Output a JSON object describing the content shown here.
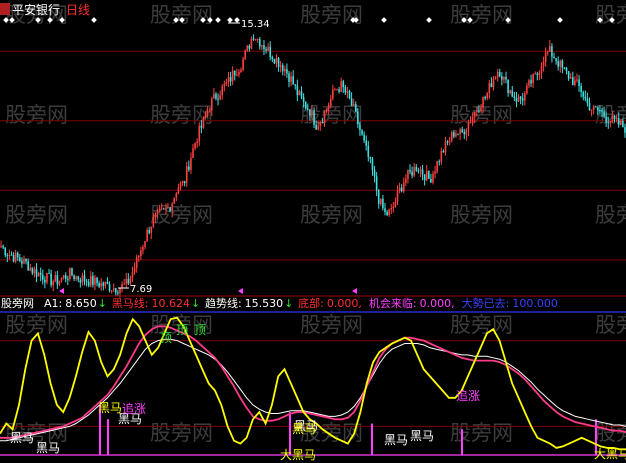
{
  "title": {
    "stock": "平安银行",
    "period": "日线"
  },
  "watermark": "股旁网",
  "price_panel": {
    "high_label": "15.34",
    "low_label": "7.69"
  },
  "indicator_header": {
    "name": "股旁网",
    "items": [
      {
        "label": "A1:",
        "value": "8.650",
        "arrow": "↓",
        "color": "#ffffff"
      },
      {
        "label": "黑马线:",
        "value": "10.624",
        "arrow": "↓",
        "color": "#ff3030"
      },
      {
        "label": "趋势线:",
        "value": "15.530",
        "arrow": "↓",
        "color": "#ffffff"
      },
      {
        "label": "底部:",
        "value": "0.000,",
        "arrow": "",
        "color": "#ff3030"
      },
      {
        "label": "机会来临:",
        "value": "0.000,",
        "arrow": "",
        "color": "#ff40ff"
      },
      {
        "label": "大勢已去:",
        "value": "100.000",
        "arrow": "",
        "color": "#4040ff"
      }
    ]
  },
  "annotations": [
    {
      "text": "黑马",
      "color": "#ffffff"
    },
    {
      "text": "黑马",
      "color": "#ffffff"
    },
    {
      "text": "黑马",
      "color": "#ffffff"
    },
    {
      "text": "黑马",
      "color": "#ffff00"
    },
    {
      "text": "追涨",
      "color": "#ff40ff"
    },
    {
      "text": "黑马",
      "color": "#ffffff"
    },
    {
      "text": "顶",
      "color": "#30e030"
    },
    {
      "text": "顶",
      "color": "#30e030"
    },
    {
      "text": "顶",
      "color": "#30e030"
    },
    {
      "text": "黑马",
      "color": "#ffff00"
    },
    {
      "text": "黑马",
      "color": "#ffffff"
    },
    {
      "text": "黑马",
      "color": "#ffffff"
    },
    {
      "text": "大黑马",
      "color": "#ffff00"
    },
    {
      "text": "追涨",
      "color": "#ff40ff"
    },
    {
      "text": "大黑马",
      "color": "#ffff00"
    }
  ],
  "chart_data": [
    {
      "type": "candlestick",
      "title": "平安银行 日线",
      "ylim": [
        7.69,
        15.34
      ],
      "y_gridlines": [
        8.5,
        10.5,
        12.5,
        14.5
      ],
      "close_profile": [
        8.9,
        8.7,
        8.6,
        8.5,
        8.4,
        8.2,
        8.1,
        8.0,
        7.9,
        7.9,
        8.0,
        8.1,
        8.0,
        7.95,
        7.9,
        7.85,
        7.8,
        7.75,
        7.7,
        7.72,
        7.8,
        8.2,
        8.7,
        9.2,
        9.6,
        9.8,
        9.9,
        10.1,
        10.6,
        10.7,
        11.4,
        12.0,
        12.4,
        12.9,
        13.2,
        13.4,
        13.6,
        13.9,
        14.1,
        14.5,
        15.0,
        14.8,
        14.6,
        14.4,
        14.2,
        14.0,
        13.7,
        13.3,
        13.0,
        12.8,
        12.4,
        12.6,
        13.0,
        13.4,
        13.5,
        13.2,
        12.8,
        12.2,
        11.6,
        11.0,
        10.2,
        9.8,
        9.9,
        10.4,
        10.8,
        11.0,
        11.2,
        11.0,
        10.8,
        11.2,
        11.6,
        11.9,
        12.2,
        12.1,
        12.4,
        12.7,
        13.0,
        13.2,
        13.7,
        14.0,
        13.6,
        13.3,
        13.1,
        13.2,
        13.6,
        13.8,
        14.3,
        14.5,
        14.3,
        14.0,
        13.8,
        13.6,
        13.4,
        13.0,
        12.8,
        12.8,
        12.6,
        12.5,
        12.4,
        12.3
      ]
    },
    {
      "type": "line",
      "title": "股旁网",
      "ylim": [
        0,
        100
      ],
      "series": [
        {
          "name": "A1",
          "color": "#ffff00",
          "values": [
            15,
            22,
            18,
            35,
            60,
            80,
            85,
            70,
            50,
            35,
            30,
            40,
            55,
            72,
            86,
            80,
            65,
            55,
            60,
            70,
            85,
            95,
            90,
            80,
            70,
            75,
            85,
            95,
            96,
            90,
            80,
            70,
            60,
            50,
            45,
            35,
            20,
            10,
            8,
            12,
            25,
            30,
            22,
            35,
            55,
            60,
            50,
            40,
            30,
            25,
            22,
            18,
            15,
            12,
            10,
            8,
            15,
            30,
            50,
            65,
            72,
            75,
            78,
            80,
            82,
            80,
            70,
            60,
            55,
            50,
            45,
            40,
            40,
            45,
            55,
            65,
            75,
            85,
            88,
            80,
            65,
            50,
            40,
            30,
            20,
            12,
            10,
            8,
            5,
            6,
            8,
            10,
            12,
            10,
            8,
            6,
            5,
            5,
            4,
            4
          ]
        },
        {
          "name": "黑马线",
          "color": "#ff3a8a",
          "values": [
            12,
            12,
            12,
            13,
            14,
            15,
            16,
            17,
            18,
            19,
            20,
            22,
            24,
            26,
            30,
            34,
            38,
            42,
            48,
            55,
            62,
            70,
            78,
            84,
            88,
            90,
            90,
            89,
            87,
            85,
            83,
            80,
            76,
            72,
            68,
            62,
            55,
            48,
            40,
            33,
            27,
            25,
            24,
            24,
            25,
            27,
            29,
            30,
            30,
            29,
            28,
            27,
            26,
            25,
            25,
            26,
            30,
            38,
            48,
            58,
            68,
            74,
            78,
            80,
            82,
            82,
            81,
            80,
            78,
            76,
            74,
            72,
            70,
            68,
            67,
            66,
            66,
            66,
            66,
            65,
            63,
            60,
            57,
            53,
            48,
            43,
            38,
            34,
            30,
            27,
            25,
            23,
            22,
            21,
            20,
            19,
            18,
            17,
            17,
            16
          ]
        },
        {
          "name": "趋势线",
          "color": "#ffffff",
          "values": [
            10,
            10,
            11,
            12,
            13,
            14,
            15,
            16,
            17,
            18,
            19,
            20,
            22,
            25,
            28,
            32,
            36,
            40,
            45,
            50,
            56,
            62,
            68,
            74,
            78,
            80,
            81,
            81,
            80,
            78,
            76,
            74,
            72,
            70,
            67,
            63,
            58,
            52,
            46,
            40,
            35,
            32,
            30,
            29,
            29,
            30,
            31,
            31,
            31,
            30,
            29,
            28,
            27,
            27,
            28,
            30,
            34,
            40,
            48,
            56,
            64,
            70,
            74,
            76,
            78,
            78,
            78,
            77,
            75,
            74,
            73,
            72,
            71,
            70,
            70,
            69,
            69,
            69,
            68,
            67,
            65,
            62,
            59,
            55,
            51,
            46,
            42,
            38,
            34,
            31,
            29,
            27,
            26,
            25,
            24,
            23,
            22,
            21,
            21,
            20
          ]
        }
      ]
    }
  ]
}
